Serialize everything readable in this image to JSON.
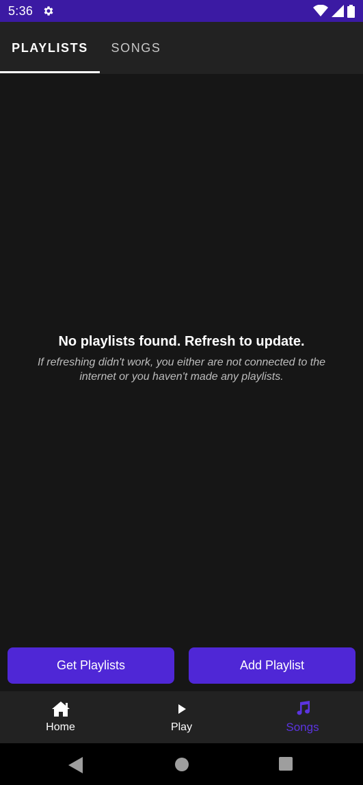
{
  "status_bar": {
    "time": "5:36",
    "icons": [
      "gear-icon",
      "wifi-icon",
      "signal-icon",
      "battery-icon"
    ],
    "background": "#3b1aa3"
  },
  "tabs": [
    {
      "label": "PLAYLISTS",
      "selected": true
    },
    {
      "label": "SONGS",
      "selected": false
    }
  ],
  "empty_state": {
    "title": "No playlists found. Refresh to update.",
    "subtitle": "If refreshing didn't work, you either are not connected to the internet or you haven't made any playlists."
  },
  "actions": {
    "get_playlists_label": "Get Playlists",
    "add_playlist_label": "Add Playlist",
    "accent": "#4f27d6"
  },
  "bottom_nav": [
    {
      "label": "Home",
      "icon": "home-icon",
      "selected": false
    },
    {
      "label": "Play",
      "icon": "play-icon",
      "selected": false
    },
    {
      "label": "Songs",
      "icon": "music-note-icon",
      "selected": true
    }
  ],
  "system_nav": [
    "back-icon",
    "home-circle-icon",
    "recents-icon"
  ]
}
